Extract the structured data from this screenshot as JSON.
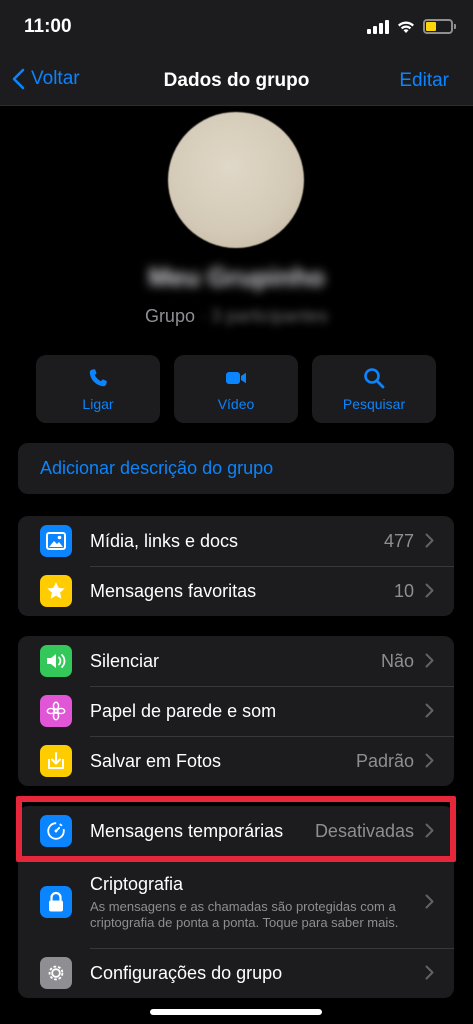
{
  "status_bar": {
    "time": "11:00"
  },
  "nav": {
    "back_label": "Voltar",
    "title": "Dados do grupo",
    "edit_label": "Editar"
  },
  "group": {
    "name": "Meu Grupinho",
    "type_label": "Grupo",
    "participants": "3 participantes"
  },
  "actions": [
    {
      "label": "Ligar",
      "icon": "phone-icon"
    },
    {
      "label": "Vídeo",
      "icon": "video-camera-icon"
    },
    {
      "label": "Pesquisar",
      "icon": "search-icon"
    }
  ],
  "description_link": "Adicionar descrição do grupo",
  "section_media": [
    {
      "label": "Mídia, links e docs",
      "value": "477",
      "icon": "photo-icon",
      "color": "#0a84ff"
    },
    {
      "label": "Mensagens favoritas",
      "value": "10",
      "icon": "star-icon",
      "color": "#ffcc00"
    }
  ],
  "section_settings": [
    {
      "label": "Silenciar",
      "value": "Não",
      "icon": "speaker-icon",
      "color": "#34c759"
    },
    {
      "label": "Papel de parede e som",
      "value": "",
      "icon": "flower-icon",
      "color": "#e056d6"
    },
    {
      "label": "Salvar em Fotos",
      "value": "Padrão",
      "icon": "download-icon",
      "color": "#ffcc00"
    }
  ],
  "section_privacy": [
    {
      "label": "Mensagens temporárias",
      "value": "Desativadas",
      "icon": "timer-icon",
      "color": "#0a84ff"
    },
    {
      "label": "Criptografia",
      "description": "As mensagens e as chamadas são protegidas com a criptografia de ponta a ponta. Toque para saber mais.",
      "icon": "lock-icon",
      "color": "#0a84ff"
    },
    {
      "label": "Configurações do grupo",
      "icon": "gear-icon",
      "color": "#8e8e93"
    }
  ],
  "colors": {
    "accent": "#0a84ff",
    "highlight": "#e5263b"
  }
}
